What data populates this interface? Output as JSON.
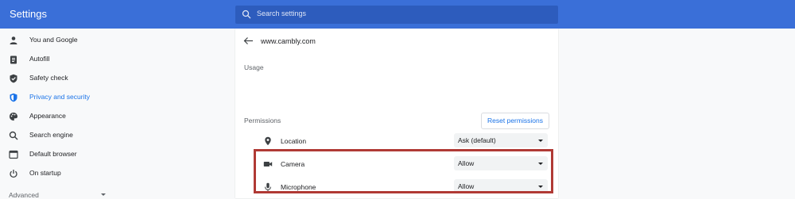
{
  "header": {
    "title": "Settings",
    "search_placeholder": "Search settings"
  },
  "sidebar": {
    "items": [
      {
        "label": "You and Google",
        "icon": "person-icon"
      },
      {
        "label": "Autofill",
        "icon": "clipboard-icon"
      },
      {
        "label": "Safety check",
        "icon": "shield-check-icon"
      },
      {
        "label": "Privacy and security",
        "icon": "shield-icon",
        "active": true
      },
      {
        "label": "Appearance",
        "icon": "palette-icon"
      },
      {
        "label": "Search engine",
        "icon": "search-icon"
      },
      {
        "label": "Default browser",
        "icon": "browser-icon"
      },
      {
        "label": "On startup",
        "icon": "power-icon"
      }
    ],
    "advanced_label": "Advanced"
  },
  "site": {
    "name": "www.cambly.com",
    "usage_label": "Usage",
    "permissions_label": "Permissions",
    "reset_label": "Reset permissions",
    "permissions": [
      {
        "label": "Location",
        "value": "Ask (default)",
        "icon": "location-pin-icon"
      },
      {
        "label": "Camera",
        "value": "Allow",
        "icon": "camera-icon"
      },
      {
        "label": "Microphone",
        "value": "Allow",
        "icon": "microphone-icon"
      }
    ]
  },
  "colors": {
    "header": "#3a6fd8",
    "accent": "#1a73e8",
    "highlight": "#b03a35"
  }
}
